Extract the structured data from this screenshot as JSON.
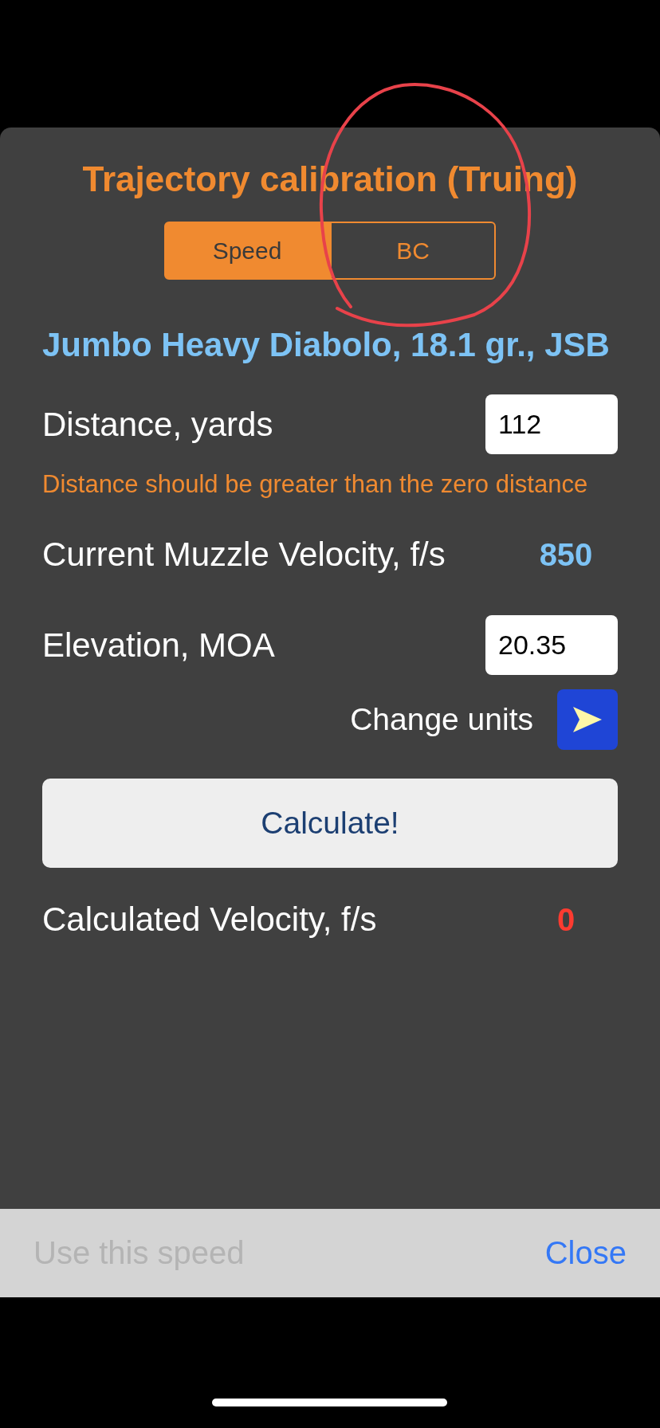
{
  "dialog": {
    "title": "Trajectory calibration (Truing)",
    "segments": [
      {
        "label": "Speed",
        "selected": true
      },
      {
        "label": "BC",
        "selected": false
      }
    ],
    "projectile": "Jumbo Heavy Diabolo, 18.1 gr., JSB",
    "distance": {
      "label": "Distance, yards",
      "value": "112"
    },
    "error": "Distance should be greater than the zero distance",
    "muzzle_velocity": {
      "label": "Current Muzzle Velocity, f/s",
      "value": "850"
    },
    "elevation": {
      "label": "Elevation, MOA",
      "value": "20.35"
    },
    "change_units": {
      "label": "Change units"
    },
    "calculate_button": "Calculate!",
    "calculated_velocity": {
      "label": "Calculated Velocity, f/s",
      "value": "0"
    },
    "footer_buttons": [
      {
        "label": "Use this speed",
        "disabled": true
      },
      {
        "label": "Close",
        "disabled": false
      }
    ]
  },
  "annotation": {
    "kind": "circle"
  }
}
